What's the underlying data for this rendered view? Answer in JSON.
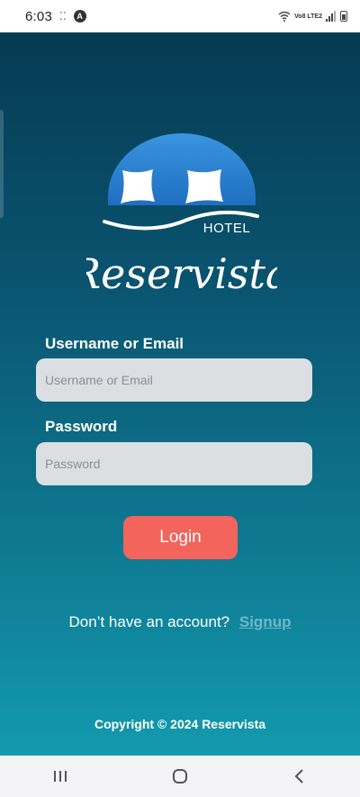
{
  "status_bar": {
    "time": "6:03",
    "icons": [
      "screen-record-icon",
      "a-badge-icon",
      "wifi-icon",
      "volte-icon",
      "signal-icon",
      "battery-icon"
    ],
    "volte_text": "Vo8 LTE2"
  },
  "logo": {
    "hotel_text": "HOTEL",
    "brand": "Reservista",
    "colors": {
      "dome": "#2a86d8",
      "pillows": "#ffffff"
    }
  },
  "form": {
    "username": {
      "label": "Username or Email",
      "placeholder": "Username or Email",
      "value": ""
    },
    "password": {
      "label": "Password",
      "placeholder": "Password",
      "value": ""
    },
    "login_label": "Login"
  },
  "signup": {
    "prompt": "Don’t have an account?",
    "link": "Signup"
  },
  "footer": {
    "copyright": "Copyright © 2024 Reservista"
  },
  "nav": {
    "icons": [
      "recent-apps-icon",
      "home-icon",
      "back-icon"
    ]
  },
  "colors": {
    "bg_top": "#053b52",
    "bg_bottom": "#139aae",
    "button": "#f2645c",
    "input_bg": "#dcdfe2",
    "link": "#6fb8cc"
  }
}
